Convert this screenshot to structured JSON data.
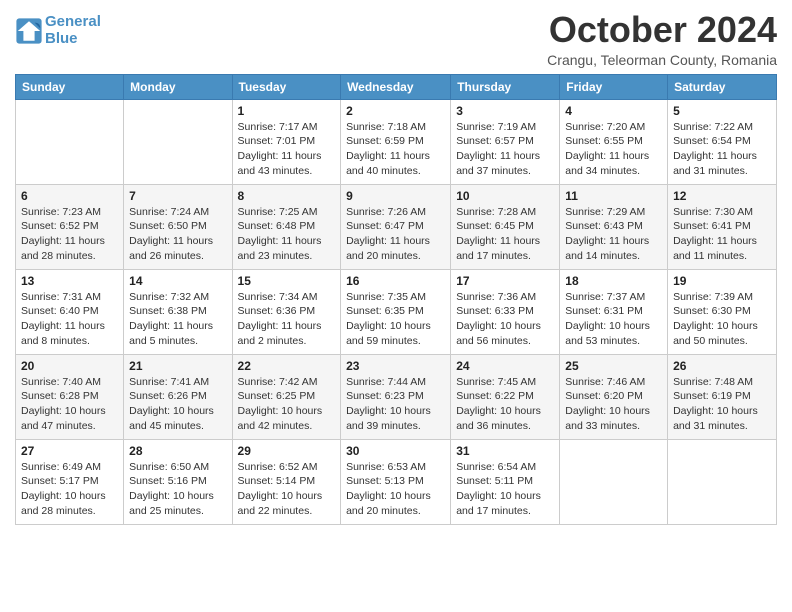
{
  "logo": {
    "line1": "General",
    "line2": "Blue"
  },
  "title": "October 2024",
  "subtitle": "Crangu, Teleorman County, Romania",
  "header_days": [
    "Sunday",
    "Monday",
    "Tuesday",
    "Wednesday",
    "Thursday",
    "Friday",
    "Saturday"
  ],
  "weeks": [
    [
      {
        "day": "",
        "info": ""
      },
      {
        "day": "",
        "info": ""
      },
      {
        "day": "1",
        "info": "Sunrise: 7:17 AM\nSunset: 7:01 PM\nDaylight: 11 hours\nand 43 minutes."
      },
      {
        "day": "2",
        "info": "Sunrise: 7:18 AM\nSunset: 6:59 PM\nDaylight: 11 hours\nand 40 minutes."
      },
      {
        "day": "3",
        "info": "Sunrise: 7:19 AM\nSunset: 6:57 PM\nDaylight: 11 hours\nand 37 minutes."
      },
      {
        "day": "4",
        "info": "Sunrise: 7:20 AM\nSunset: 6:55 PM\nDaylight: 11 hours\nand 34 minutes."
      },
      {
        "day": "5",
        "info": "Sunrise: 7:22 AM\nSunset: 6:54 PM\nDaylight: 11 hours\nand 31 minutes."
      }
    ],
    [
      {
        "day": "6",
        "info": "Sunrise: 7:23 AM\nSunset: 6:52 PM\nDaylight: 11 hours\nand 28 minutes."
      },
      {
        "day": "7",
        "info": "Sunrise: 7:24 AM\nSunset: 6:50 PM\nDaylight: 11 hours\nand 26 minutes."
      },
      {
        "day": "8",
        "info": "Sunrise: 7:25 AM\nSunset: 6:48 PM\nDaylight: 11 hours\nand 23 minutes."
      },
      {
        "day": "9",
        "info": "Sunrise: 7:26 AM\nSunset: 6:47 PM\nDaylight: 11 hours\nand 20 minutes."
      },
      {
        "day": "10",
        "info": "Sunrise: 7:28 AM\nSunset: 6:45 PM\nDaylight: 11 hours\nand 17 minutes."
      },
      {
        "day": "11",
        "info": "Sunrise: 7:29 AM\nSunset: 6:43 PM\nDaylight: 11 hours\nand 14 minutes."
      },
      {
        "day": "12",
        "info": "Sunrise: 7:30 AM\nSunset: 6:41 PM\nDaylight: 11 hours\nand 11 minutes."
      }
    ],
    [
      {
        "day": "13",
        "info": "Sunrise: 7:31 AM\nSunset: 6:40 PM\nDaylight: 11 hours\nand 8 minutes."
      },
      {
        "day": "14",
        "info": "Sunrise: 7:32 AM\nSunset: 6:38 PM\nDaylight: 11 hours\nand 5 minutes."
      },
      {
        "day": "15",
        "info": "Sunrise: 7:34 AM\nSunset: 6:36 PM\nDaylight: 11 hours\nand 2 minutes."
      },
      {
        "day": "16",
        "info": "Sunrise: 7:35 AM\nSunset: 6:35 PM\nDaylight: 10 hours\nand 59 minutes."
      },
      {
        "day": "17",
        "info": "Sunrise: 7:36 AM\nSunset: 6:33 PM\nDaylight: 10 hours\nand 56 minutes."
      },
      {
        "day": "18",
        "info": "Sunrise: 7:37 AM\nSunset: 6:31 PM\nDaylight: 10 hours\nand 53 minutes."
      },
      {
        "day": "19",
        "info": "Sunrise: 7:39 AM\nSunset: 6:30 PM\nDaylight: 10 hours\nand 50 minutes."
      }
    ],
    [
      {
        "day": "20",
        "info": "Sunrise: 7:40 AM\nSunset: 6:28 PM\nDaylight: 10 hours\nand 47 minutes."
      },
      {
        "day": "21",
        "info": "Sunrise: 7:41 AM\nSunset: 6:26 PM\nDaylight: 10 hours\nand 45 minutes."
      },
      {
        "day": "22",
        "info": "Sunrise: 7:42 AM\nSunset: 6:25 PM\nDaylight: 10 hours\nand 42 minutes."
      },
      {
        "day": "23",
        "info": "Sunrise: 7:44 AM\nSunset: 6:23 PM\nDaylight: 10 hours\nand 39 minutes."
      },
      {
        "day": "24",
        "info": "Sunrise: 7:45 AM\nSunset: 6:22 PM\nDaylight: 10 hours\nand 36 minutes."
      },
      {
        "day": "25",
        "info": "Sunrise: 7:46 AM\nSunset: 6:20 PM\nDaylight: 10 hours\nand 33 minutes."
      },
      {
        "day": "26",
        "info": "Sunrise: 7:48 AM\nSunset: 6:19 PM\nDaylight: 10 hours\nand 31 minutes."
      }
    ],
    [
      {
        "day": "27",
        "info": "Sunrise: 6:49 AM\nSunset: 5:17 PM\nDaylight: 10 hours\nand 28 minutes."
      },
      {
        "day": "28",
        "info": "Sunrise: 6:50 AM\nSunset: 5:16 PM\nDaylight: 10 hours\nand 25 minutes."
      },
      {
        "day": "29",
        "info": "Sunrise: 6:52 AM\nSunset: 5:14 PM\nDaylight: 10 hours\nand 22 minutes."
      },
      {
        "day": "30",
        "info": "Sunrise: 6:53 AM\nSunset: 5:13 PM\nDaylight: 10 hours\nand 20 minutes."
      },
      {
        "day": "31",
        "info": "Sunrise: 6:54 AM\nSunset: 5:11 PM\nDaylight: 10 hours\nand 17 minutes."
      },
      {
        "day": "",
        "info": ""
      },
      {
        "day": "",
        "info": ""
      }
    ]
  ]
}
